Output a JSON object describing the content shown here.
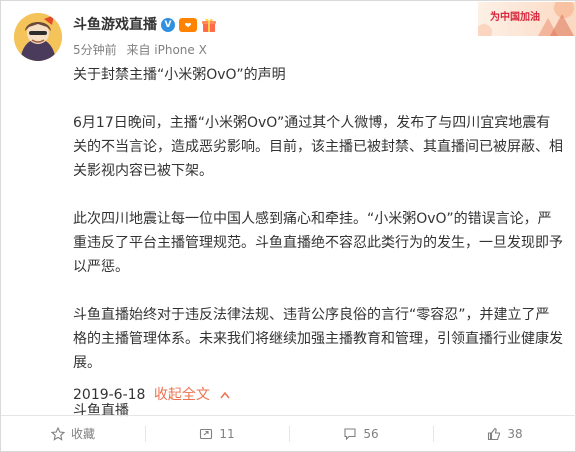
{
  "post": {
    "author": "斗鱼游戏直播",
    "meta": {
      "time": "5分钟前",
      "source": "来自 iPhone X"
    },
    "banner_text": "为中国加油",
    "title": "关于封禁主播“小米粥OvO”的声明",
    "paragraphs": [
      "6月17日晚间，主播“小米粥OvO”通过其个人微博，发布了与四川宜宾地震有关的不当言论，造成恶劣影响。目前，该主播已被封禁、其直播间已被屏蔽、相关影视内容已被下架。",
      "此次四川地震让每一位中国人感到痛心和牵挂。“小米粥OvO”的错误言论，严重违反了平台主播管理规范。斗鱼直播绝不容忍此类行为的发生，一旦发现即予以严惩。",
      "斗鱼直播始终对于违反法律法规、违背公序良俗的言行“零容忍”，并建立了严格的主播管理体系。未来我们将继续加强主播教育和管理，引领直播行业健康发展。"
    ],
    "signature": "斗鱼直播",
    "date": "2019-6-18",
    "collapse_label": "收起全文"
  },
  "actions": {
    "favorite": "收藏",
    "repost": "11",
    "comment": "56",
    "like": "38"
  },
  "colors": {
    "link": "#eb7350",
    "meta": "#808080",
    "text": "#333333",
    "verified": "#2f8fe0"
  }
}
